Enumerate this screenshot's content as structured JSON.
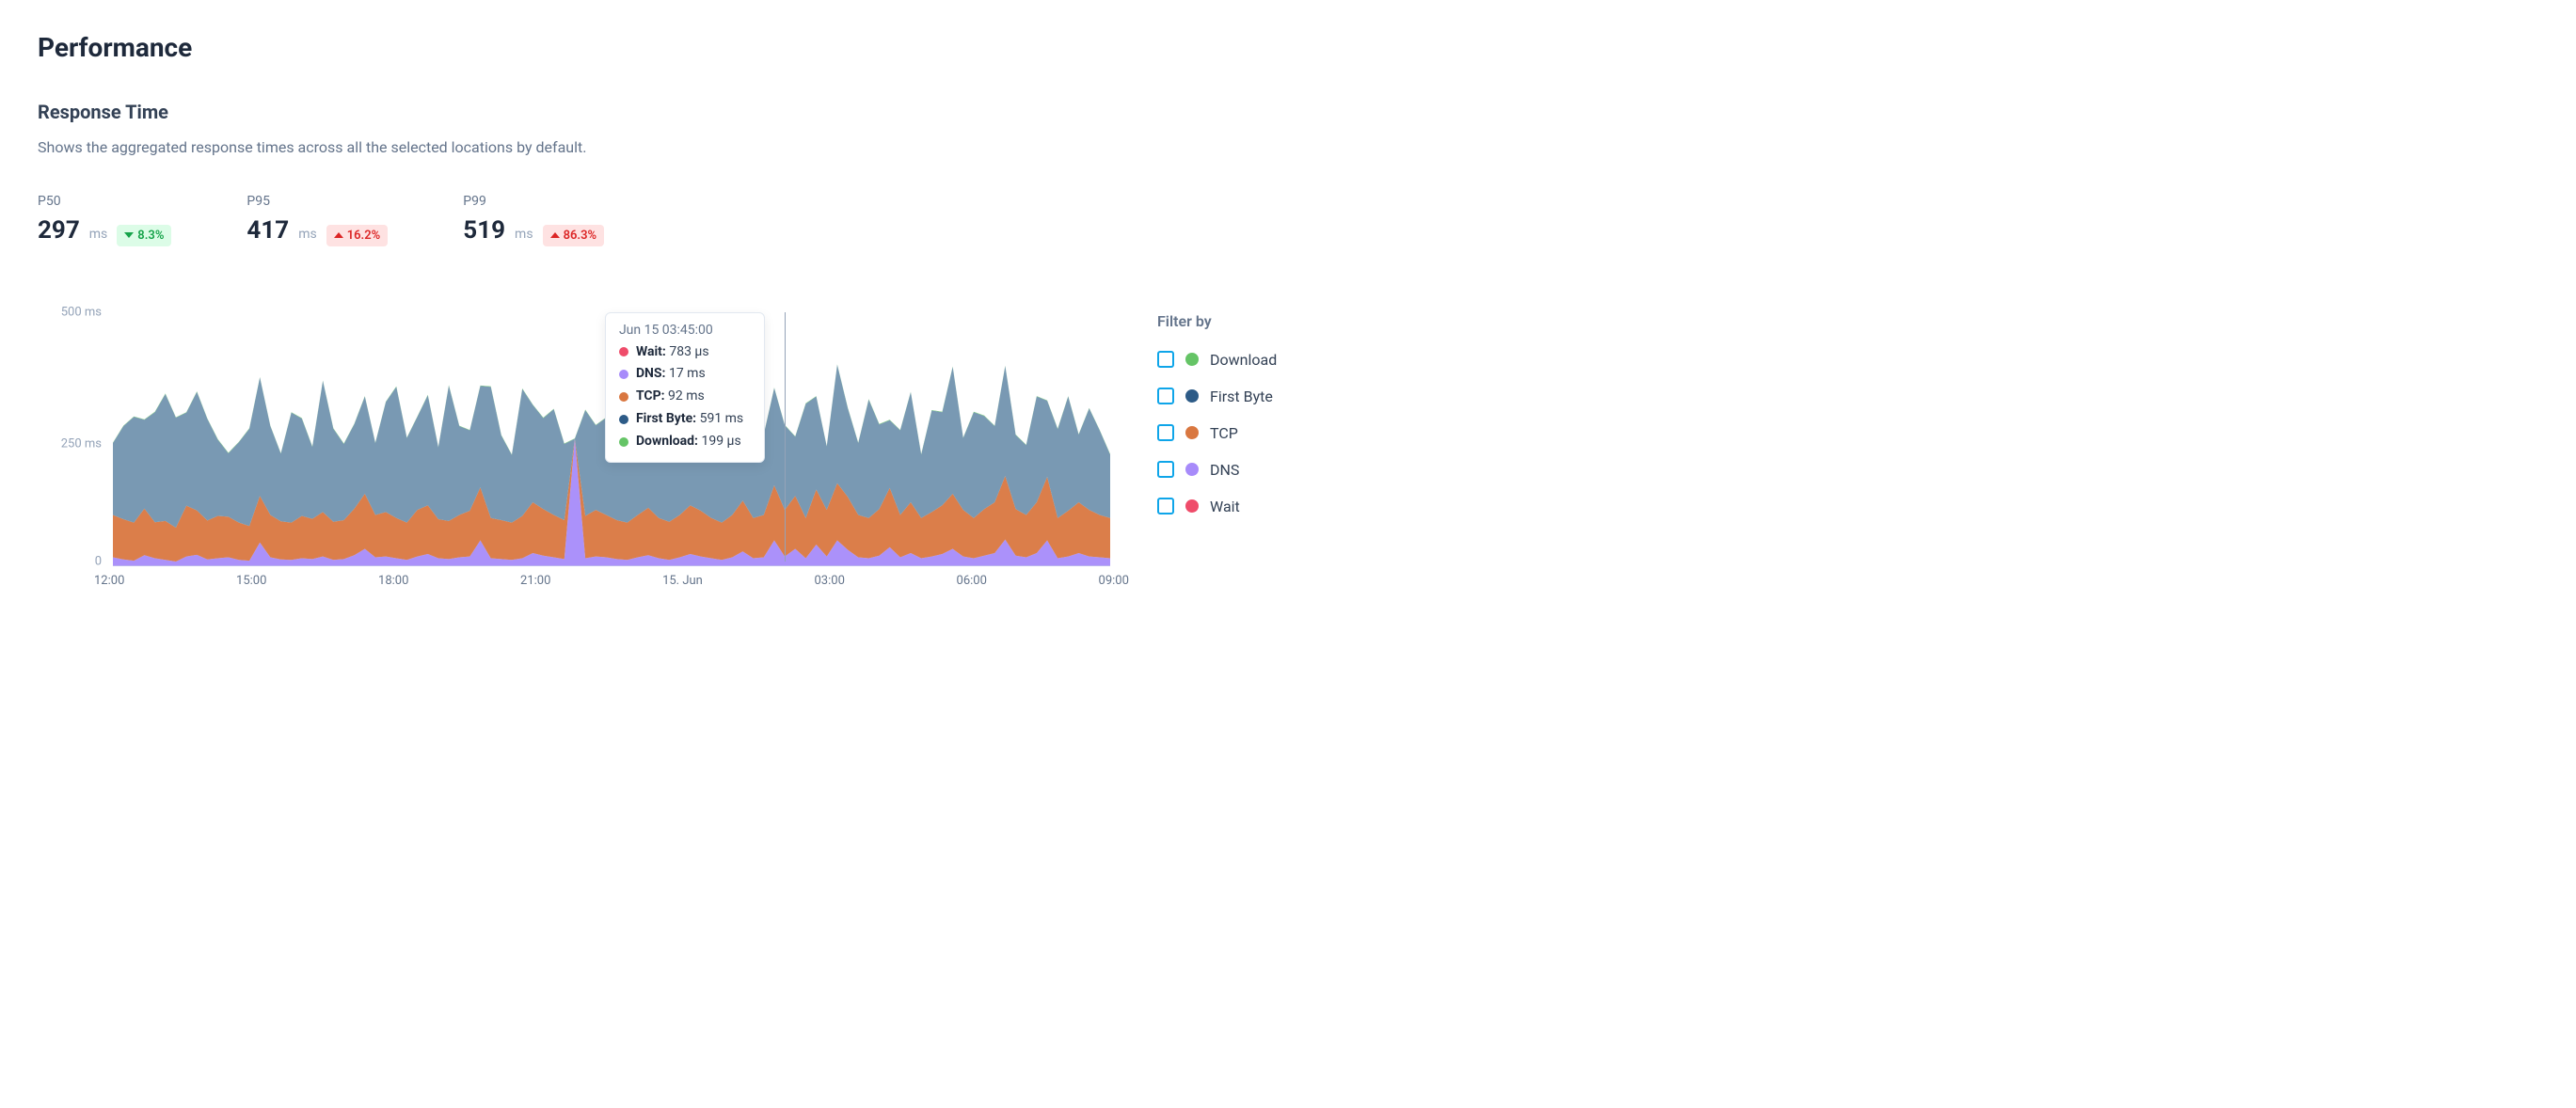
{
  "page": {
    "title": "Performance",
    "section_title": "Response Time",
    "section_desc": "Shows the aggregated response times across all the selected locations by default."
  },
  "metrics": [
    {
      "label": "P50",
      "value": "297",
      "unit": "ms",
      "delta": "8.3%",
      "dir": "down"
    },
    {
      "label": "P95",
      "value": "417",
      "unit": "ms",
      "delta": "16.2%",
      "dir": "up"
    },
    {
      "label": "P99",
      "value": "519",
      "unit": "ms",
      "delta": "86.3%",
      "dir": "up"
    }
  ],
  "colors": {
    "wait": "#ef4c6a",
    "dns": "#a78bfa",
    "tcp": "#d97740",
    "firstbyte": "#6a8eab",
    "download": "#65c466"
  },
  "filter": {
    "title": "Filter by",
    "items": [
      {
        "key": "download",
        "label": "Download",
        "color": "#65c466"
      },
      {
        "key": "firstbyte",
        "label": "First Byte",
        "color": "#2d5b87"
      },
      {
        "key": "tcp",
        "label": "TCP",
        "color": "#d97740"
      },
      {
        "key": "dns",
        "label": "DNS",
        "color": "#a78bfa"
      },
      {
        "key": "wait",
        "label": "Wait",
        "color": "#ef4c6a"
      }
    ]
  },
  "tooltip": {
    "title": "Jun 15 03:45:00",
    "rows": [
      {
        "key": "wait",
        "label": "Wait:",
        "value": "783 µs",
        "color": "#ef4c6a"
      },
      {
        "key": "dns",
        "label": "DNS:",
        "value": "17 ms",
        "color": "#a78bfa"
      },
      {
        "key": "tcp",
        "label": "TCP:",
        "value": "92 ms",
        "color": "#d97740"
      },
      {
        "key": "firstbyte",
        "label": "First Byte:",
        "value": "591 ms",
        "color": "#2d5b87"
      },
      {
        "key": "download",
        "label": "Download:",
        "value": "199 µs",
        "color": "#65c466"
      }
    ]
  },
  "chart_data": {
    "type": "area",
    "title": "Response Time",
    "xlabel": "",
    "ylabel": "",
    "ylim": [
      0,
      600
    ],
    "x_ticks": [
      "12:00",
      "15:00",
      "18:00",
      "21:00",
      "15. Jun",
      "03:00",
      "06:00",
      "09:00"
    ],
    "y_ticks": [
      "500 ms",
      "250 ms",
      "0"
    ],
    "series_order": [
      "wait",
      "dns",
      "tcp",
      "firstbyte",
      "download"
    ],
    "series": {
      "wait": [
        1,
        1,
        1,
        1,
        1,
        1,
        1,
        1,
        1,
        1,
        1,
        1,
        1,
        1,
        1,
        1,
        1,
        1,
        1,
        1,
        1,
        1,
        1,
        1,
        1,
        1,
        1,
        1,
        1,
        1,
        1,
        1,
        1,
        1,
        1,
        1,
        1,
        1,
        1,
        1,
        1,
        1,
        1,
        1,
        1,
        1,
        1,
        1,
        1,
        1,
        1,
        1,
        1,
        1,
        1,
        1,
        1,
        1,
        1,
        1,
        1,
        1,
        1,
        1,
        1,
        1,
        1,
        1,
        1,
        1,
        1,
        1,
        1,
        1,
        1,
        1,
        1,
        1,
        1,
        1,
        1,
        1,
        1,
        1,
        1,
        1,
        1,
        1,
        1,
        1,
        1,
        1,
        1,
        1,
        1,
        1
      ],
      "dns": [
        20,
        15,
        12,
        25,
        18,
        14,
        10,
        22,
        26,
        15,
        18,
        20,
        14,
        12,
        55,
        20,
        15,
        14,
        18,
        16,
        22,
        14,
        16,
        25,
        40,
        20,
        22,
        18,
        14,
        22,
        28,
        18,
        16,
        20,
        22,
        60,
        18,
        16,
        14,
        18,
        30,
        24,
        20,
        16,
        300,
        18,
        22,
        20,
        16,
        14,
        20,
        25,
        18,
        14,
        20,
        28,
        22,
        18,
        14,
        20,
        34,
        18,
        20,
        60,
        22,
        40,
        18,
        50,
        22,
        60,
        38,
        20,
        18,
        24,
        44,
        20,
        30,
        18,
        22,
        28,
        40,
        22,
        18,
        24,
        30,
        62,
        24,
        20,
        30,
        60,
        18,
        22,
        30,
        22,
        20,
        18
      ],
      "tcp": [
        100,
        95,
        90,
        110,
        85,
        92,
        80,
        120,
        105,
        92,
        100,
        96,
        88,
        82,
        110,
        100,
        90,
        88,
        100,
        95,
        105,
        90,
        92,
        110,
        130,
        100,
        105,
        95,
        88,
        110,
        115,
        92,
        90,
        100,
        108,
        125,
        95,
        92,
        88,
        100,
        120,
        110,
        100,
        92,
        0,
        100,
        110,
        100,
        92,
        88,
        100,
        112,
        95,
        90,
        100,
        115,
        108,
        95,
        88,
        100,
        120,
        95,
        100,
        130,
        110,
        125,
        95,
        130,
        110,
        135,
        125,
        100,
        95,
        110,
        140,
        100,
        120,
        95,
        105,
        115,
        130,
        110,
        95,
        110,
        120,
        150,
        110,
        100,
        120,
        150,
        95,
        108,
        120,
        110,
        100,
        95
      ],
      "firstbyte": [
        170,
        220,
        250,
        210,
        260,
        300,
        260,
        220,
        280,
        240,
        180,
        150,
        190,
        230,
        280,
        210,
        160,
        260,
        230,
        170,
        310,
        220,
        180,
        200,
        230,
        170,
        260,
        310,
        200,
        220,
        260,
        170,
        320,
        210,
        190,
        240,
        310,
        200,
        160,
        300,
        230,
        215,
        250,
        180,
        0,
        250,
        200,
        230,
        170,
        190,
        240,
        180,
        280,
        200,
        230,
        120,
        240,
        190,
        160,
        260,
        480,
        230,
        190,
        230,
        200,
        140,
        270,
        220,
        150,
        280,
        210,
        170,
        280,
        200,
        160,
        200,
        260,
        150,
        240,
        220,
        300,
        170,
        250,
        220,
        180,
        260,
        175,
        165,
        250,
        180,
        210,
        270,
        160,
        240,
        200,
        150
      ],
      "download": [
        1,
        1,
        1,
        1,
        1,
        1,
        1,
        1,
        1,
        1,
        1,
        1,
        1,
        1,
        1,
        1,
        1,
        1,
        1,
        1,
        1,
        1,
        1,
        1,
        1,
        1,
        1,
        1,
        1,
        1,
        1,
        1,
        1,
        1,
        1,
        1,
        1,
        1,
        1,
        1,
        1,
        1,
        1,
        1,
        1,
        1,
        1,
        1,
        1,
        1,
        1,
        1,
        1,
        1,
        1,
        1,
        1,
        1,
        1,
        1,
        1,
        1,
        1,
        1,
        1,
        1,
        1,
        1,
        1,
        1,
        1,
        1,
        1,
        1,
        1,
        1,
        1,
        1,
        1,
        1,
        1,
        1,
        1,
        1,
        1,
        1,
        1,
        1,
        1,
        1,
        1,
        1,
        1,
        1,
        1,
        1
      ]
    },
    "tooltip_index": 63,
    "tooltip_point": {
      "wait_us": 783,
      "dns_ms": 17,
      "tcp_ms": 92,
      "firstbyte_ms": 591,
      "download_us": 199,
      "timestamp": "Jun 15 03:45:00"
    },
    "n_points": 96
  }
}
